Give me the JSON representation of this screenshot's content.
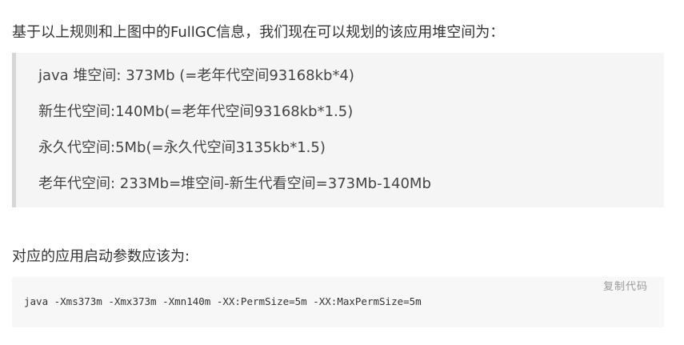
{
  "intro": {
    "text": "基于以上规则和上图中的FullGC信息，我们现在可以规划的该应用堆空间为："
  },
  "quote": {
    "lines": [
      "java 堆空间: 373Mb (=老年代空间93168kb*4)",
      "新生代空间:140Mb(=老年代空间93168kb*1.5)",
      "永久代空间:5Mb(=永久代空间3135kb*1.5)",
      "老年代空间: 233Mb=堆空间-新生代看空间=373Mb-140Mb"
    ]
  },
  "lead": {
    "text": "对应的应用启动参数应该为:"
  },
  "code": {
    "copy_label": "复制代码",
    "content": "java -Xms373m -Xmx373m -Xmn140m -XX:PermSize=5m -XX:MaxPermSize=5m"
  }
}
